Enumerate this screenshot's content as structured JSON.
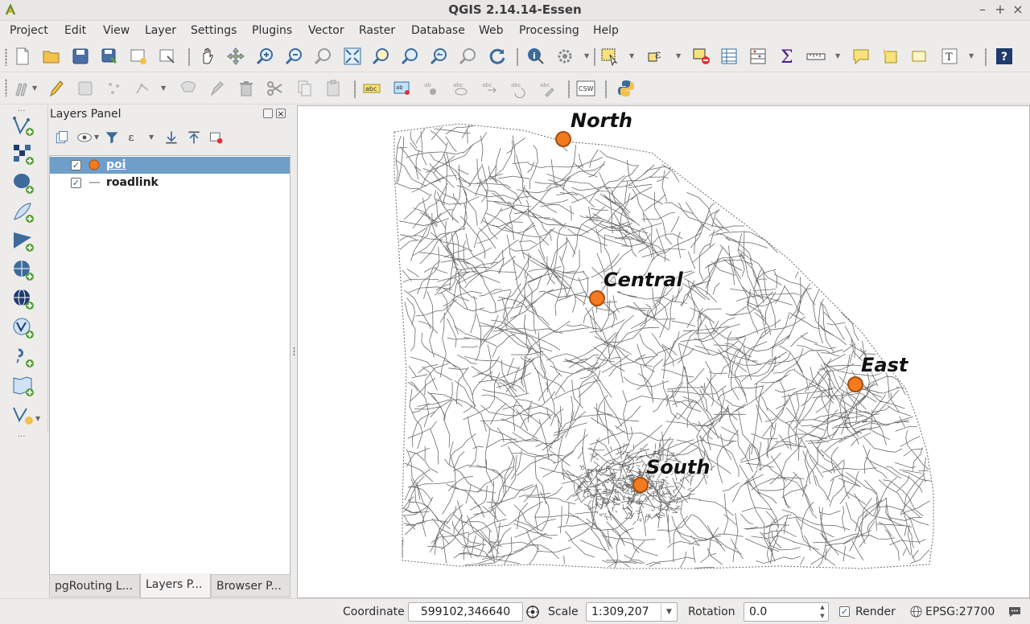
{
  "window": {
    "title": "QGIS 2.14.14-Essen"
  },
  "menu": [
    "Project",
    "Edit",
    "View",
    "Layer",
    "Settings",
    "Plugins",
    "Vector",
    "Raster",
    "Database",
    "Web",
    "Processing",
    "Help"
  ],
  "layers_panel": {
    "title": "Layers Panel",
    "layers": [
      {
        "name": "poi",
        "checked": true,
        "selected": true
      },
      {
        "name": "roadlink",
        "checked": true,
        "selected": false
      }
    ],
    "tabs": [
      "pgRouting L...",
      "Layers P...",
      "Browser P..."
    ]
  },
  "map": {
    "points": [
      {
        "name": "North"
      },
      {
        "name": "Central"
      },
      {
        "name": "East"
      },
      {
        "name": "South"
      }
    ],
    "colors": {
      "poi_fill": "#f37a1f",
      "road": "#6a6a6a"
    }
  },
  "toolbar2": {
    "csw_label": "CSW"
  },
  "status": {
    "coordinate_label": "Coordinate",
    "coordinate_value": "599102,346640",
    "scale_label": "Scale",
    "scale_value": "1:309,207",
    "rotation_label": "Rotation",
    "rotation_value": "0.0",
    "render_label": "Render",
    "crs_label": "EPSG:27700"
  }
}
